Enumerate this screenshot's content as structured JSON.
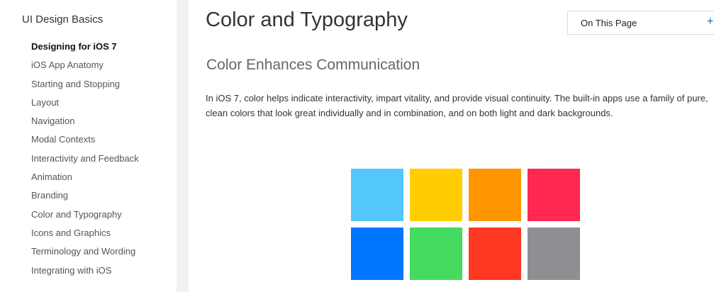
{
  "sidebar": {
    "title": "UI Design Basics",
    "items": [
      {
        "label": "Designing for iOS 7",
        "active": true
      },
      {
        "label": "iOS App Anatomy",
        "active": false
      },
      {
        "label": "Starting and Stopping",
        "active": false
      },
      {
        "label": "Layout",
        "active": false
      },
      {
        "label": "Navigation",
        "active": false
      },
      {
        "label": "Modal Contexts",
        "active": false
      },
      {
        "label": "Interactivity and Feedback",
        "active": false
      },
      {
        "label": "Animation",
        "active": false
      },
      {
        "label": "Branding",
        "active": false
      },
      {
        "label": "Color and Typography",
        "active": false
      },
      {
        "label": "Icons and Graphics",
        "active": false
      },
      {
        "label": "Terminology and Wording",
        "active": false
      },
      {
        "label": "Integrating with iOS",
        "active": false
      }
    ]
  },
  "main": {
    "title": "Color and Typography",
    "on_this_page": {
      "label": "On This Page",
      "icon": "plus-icon",
      "icon_glyph": "+"
    },
    "section_title": "Color Enhances Communication",
    "paragraph": "In iOS 7, color helps indicate interactivity, impart vitality, and provide visual continuity. The built-in apps use a family of pure, clean colors that look great individually and in combination, and on both light and dark backgrounds."
  },
  "colors": {
    "accent": "#0070c9",
    "swatches": [
      "#54c7fc",
      "#ffcd00",
      "#ff9600",
      "#ff2851",
      "#0076ff",
      "#44db5e",
      "#ff3824",
      "#8e8e93"
    ]
  }
}
